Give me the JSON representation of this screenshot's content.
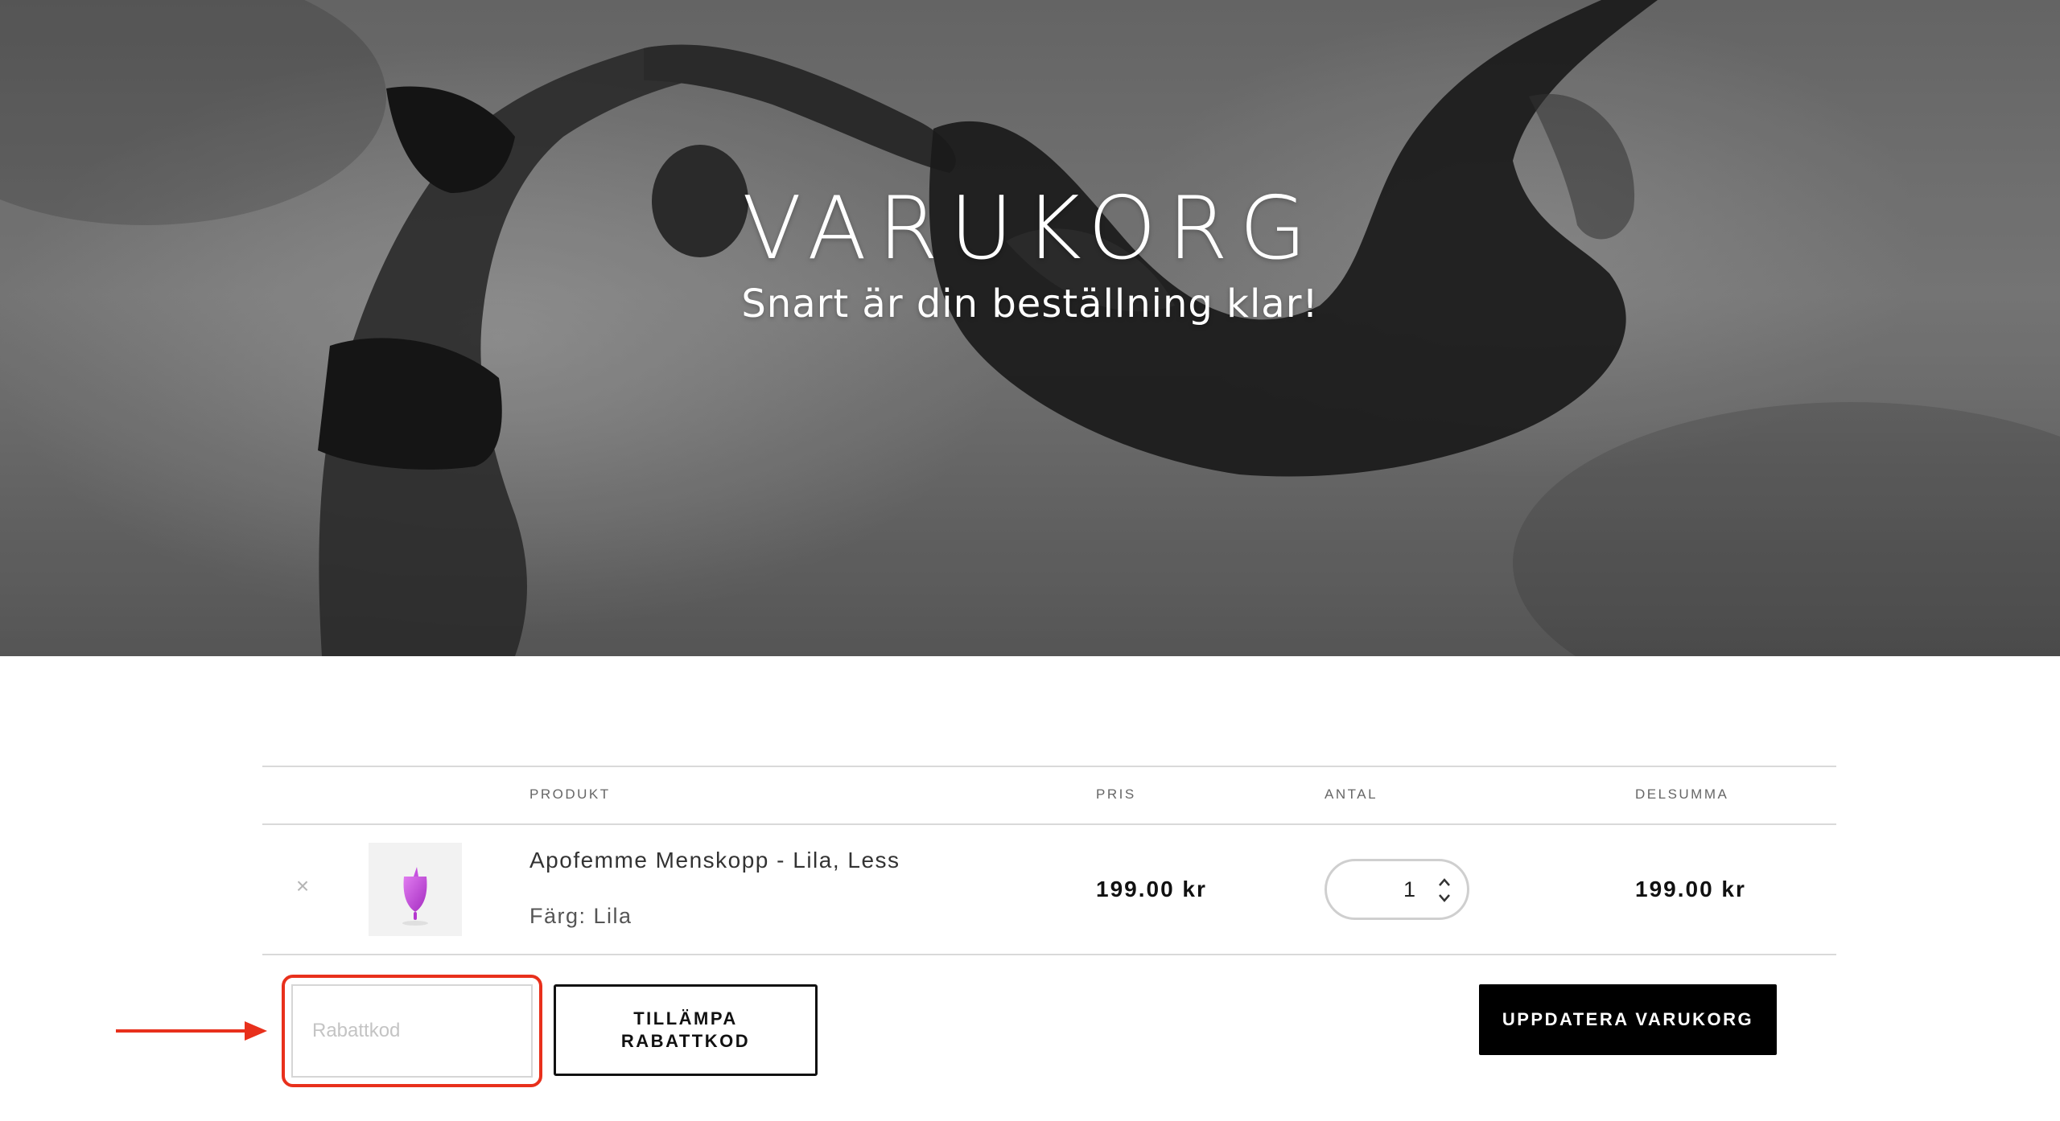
{
  "hero": {
    "title": "VARUKORG",
    "subtitle": "Snart är din beställning klar!"
  },
  "cart": {
    "columns": {
      "product": "PRODUKT",
      "price": "PRIS",
      "quantity": "ANTAL",
      "subtotal": "DELSUMMA"
    },
    "items": [
      {
        "name": "Apofemme Menskopp - Lila, Less",
        "variant": "Färg: Lila",
        "price": "199.00 kr",
        "quantity": "1",
        "subtotal": "199.00 kr",
        "thumbnail_icon": "menstrual-cup-icon",
        "thumbnail_color": "#c13fd6"
      }
    ]
  },
  "coupon": {
    "placeholder": "Rabattkod",
    "value": "",
    "apply_label": "TILLÄMPA RABATTKOD"
  },
  "actions": {
    "update_label": "UPPDATERA VARUKORG"
  },
  "annotation": {
    "highlight_color": "#e8301c",
    "arrow_icon": "arrow-right-icon"
  }
}
